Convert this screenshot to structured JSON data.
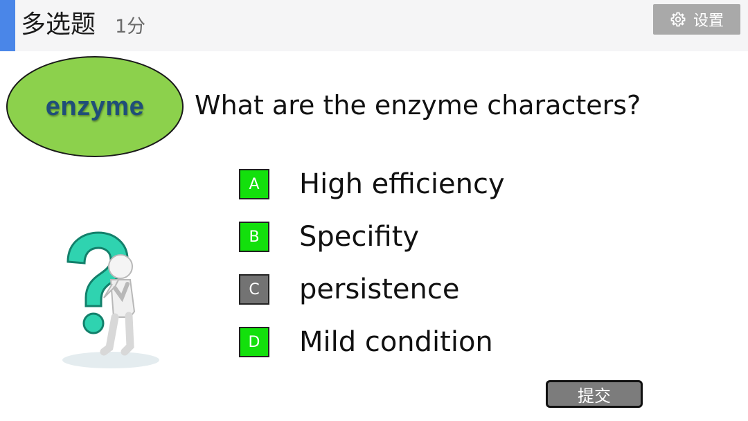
{
  "header": {
    "question_type": "多选题",
    "score": "1分",
    "settings_label": "设置",
    "settings_icon": "gear-icon"
  },
  "topic": {
    "label": "enzyme",
    "fill_color": "#8cd14c"
  },
  "question": {
    "text": "What are the enzyme characters?"
  },
  "options": [
    {
      "letter": "A",
      "text": "High efficiency",
      "selected": true,
      "color": "#13e00c"
    },
    {
      "letter": "B",
      "text": "Specifity",
      "selected": true,
      "color": "#13e00c"
    },
    {
      "letter": "C",
      "text": "persistence",
      "selected": false,
      "color": "#737373"
    },
    {
      "letter": "D",
      "text": "Mild condition",
      "selected": true,
      "color": "#13e00c"
    }
  ],
  "submit": {
    "label": "提交"
  },
  "illustration": {
    "icon": "question-mark-thinking-figure-icon"
  }
}
